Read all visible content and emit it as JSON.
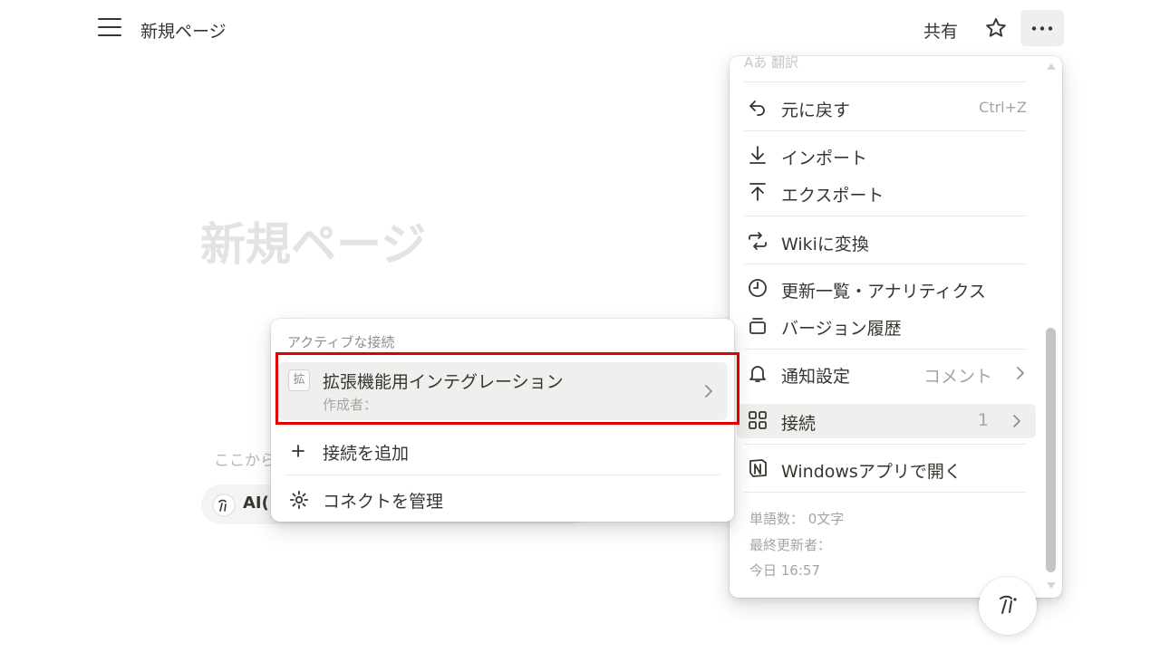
{
  "topbar": {
    "breadcrumb": "新規ページ",
    "share_label": "共有"
  },
  "page": {
    "title": "新規ページ",
    "hint": "ここから",
    "ai_chip_label": "AI(",
    "accent": "#37352f"
  },
  "menu": {
    "faded_top_label": "Aあ 翻訳",
    "undo": {
      "label": "元に戻す",
      "shortcut": "Ctrl+Z"
    },
    "import": {
      "label": "インポート"
    },
    "export": {
      "label": "エクスポート"
    },
    "wiki": {
      "label": "Wikiに変換"
    },
    "updates": {
      "label": "更新一覧・アナリティクス"
    },
    "versions": {
      "label": "バージョン履歴"
    },
    "notify": {
      "label": "通知設定",
      "value": "コメント"
    },
    "connections": {
      "label": "接続",
      "value": "1"
    },
    "windows": {
      "label": "Windowsアプリで開く"
    },
    "meta": {
      "word_count": "単語数： 0文字",
      "last_editor": "最終更新者：",
      "last_edited": "今日 16:57"
    }
  },
  "submenu": {
    "section_title": "アクティブな接続",
    "connection": {
      "badge": "拡",
      "name": "拡張機能用インテグレーション",
      "author": "作成者："
    },
    "add_connection": "接続を追加",
    "manage_connections": "コネクトを管理"
  },
  "colors": {
    "highlight": "#e00000",
    "hover_bg": "#efefee"
  }
}
